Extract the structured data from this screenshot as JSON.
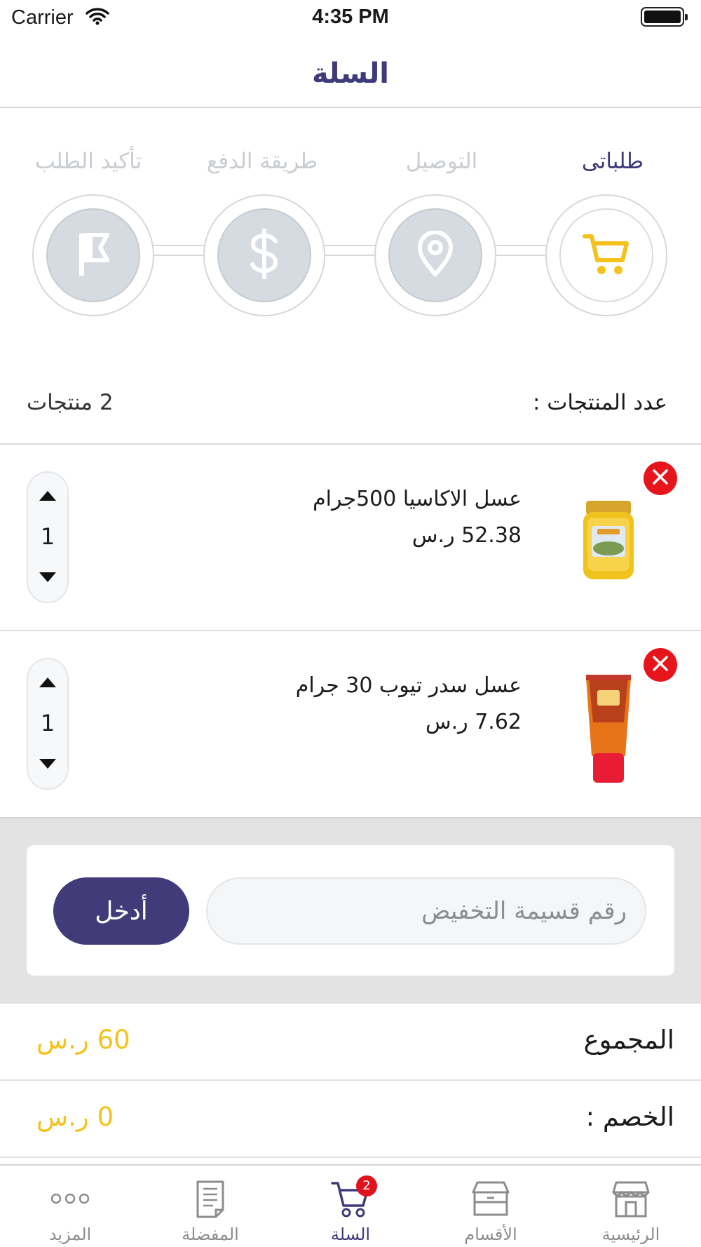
{
  "status_bar": {
    "carrier": "Carrier",
    "time": "4:35 PM"
  },
  "nav": {
    "title": "السلة"
  },
  "steps": [
    {
      "label": "طلباتى",
      "icon": "cart-icon",
      "active": true
    },
    {
      "label": "التوصيل",
      "icon": "location-pin-icon",
      "active": false
    },
    {
      "label": "طريقة الدفع",
      "icon": "dollar-icon",
      "active": false
    },
    {
      "label": "تأكيد الطلب",
      "icon": "flag-icon",
      "active": false
    }
  ],
  "cart": {
    "count_label": "عدد المنتجات :",
    "count_value": "2  منتجات",
    "items": [
      {
        "name": "عسل الاكاسيا 500جرام",
        "price": "52.38 ر.س",
        "quantity": "1",
        "image": "honey-jar-image"
      },
      {
        "name": "عسل سدر تيوب 30 جرام",
        "price": "7.62 ر.س",
        "quantity": "1",
        "image": "honey-tube-image"
      }
    ]
  },
  "coupon": {
    "placeholder": "رقم قسيمة التخفيض",
    "submit_label": "أدخل"
  },
  "summary": {
    "total_label": "المجموع",
    "total_value": "60 ر.س",
    "discount_label": "الخصم :",
    "discount_value": "0 ر.س"
  },
  "tab_bar": {
    "tabs": [
      {
        "label": "الرئيسية",
        "icon": "store-icon"
      },
      {
        "label": "الأقسام",
        "icon": "box-icon"
      },
      {
        "label": "السلة",
        "icon": "cart-icon",
        "badge": "2",
        "active": true
      },
      {
        "label": "المفضلة",
        "icon": "document-icon"
      },
      {
        "label": "المزيد",
        "icon": "more-dots-icon"
      }
    ]
  },
  "colors": {
    "primary": "#3f3a78",
    "accent": "#f4c21b",
    "danger": "#e8141c",
    "inactive": "#c9ccd1"
  }
}
